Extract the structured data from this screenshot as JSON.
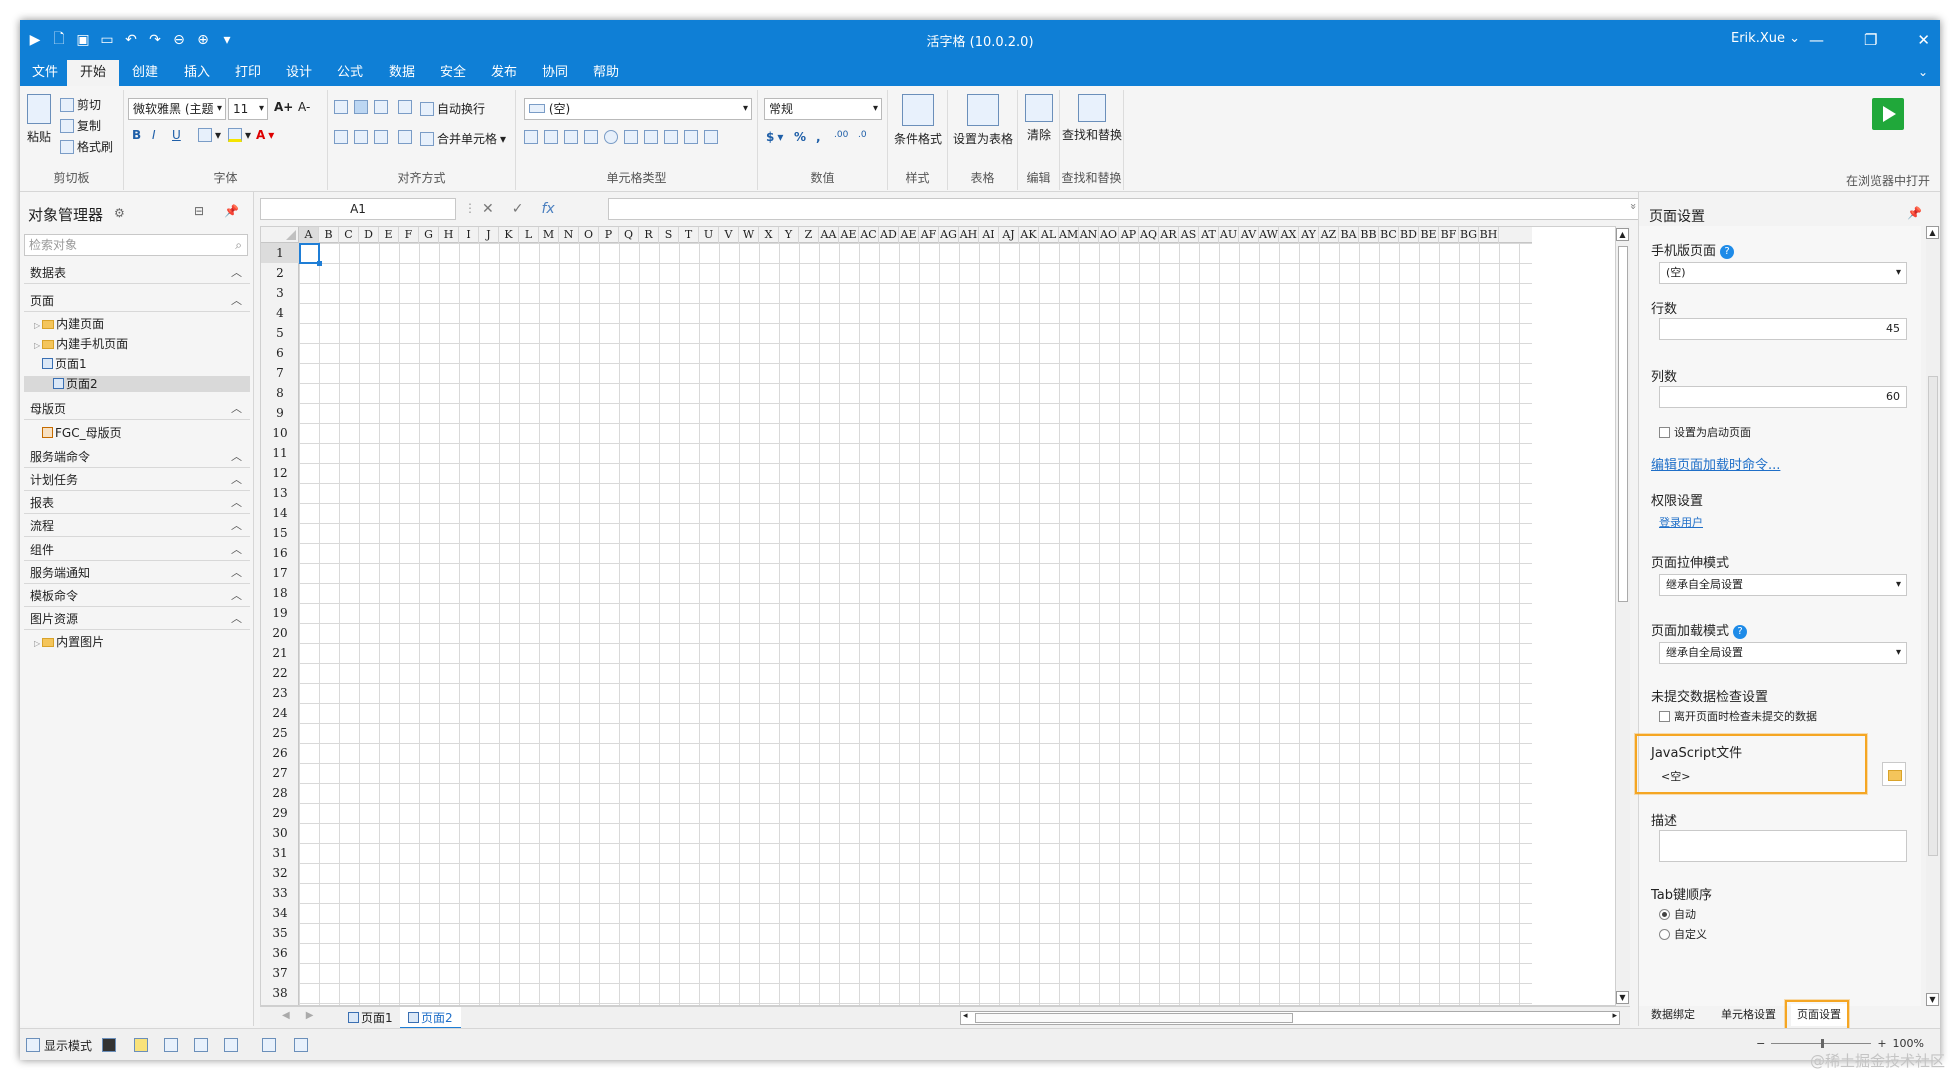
{
  "window": {
    "title": "活字格 (10.0.2.0)",
    "user": "Erik.Xue ⌄",
    "controls": [
      "—",
      "❐",
      "✕"
    ]
  },
  "menu": {
    "tabs": [
      "文件",
      "开始",
      "创建",
      "插入",
      "打印",
      "设计",
      "公式",
      "数据",
      "安全",
      "发布",
      "协同",
      "帮助"
    ],
    "active": "开始"
  },
  "ribbon": {
    "clipboard": {
      "paste": "粘贴",
      "cut": "剪切",
      "copy": "复制",
      "format_painter": "格式刷",
      "title": "剪切板"
    },
    "font": {
      "font_name": "微软雅黑 (主题",
      "font_size": "11",
      "bold": "B",
      "italic": "I",
      "underline": "U",
      "grow": "A+",
      "shrink": "A-",
      "title": "字体"
    },
    "alignment": {
      "wrap": "自动换行",
      "merge": "合并单元格",
      "title": "对齐方式"
    },
    "celltype": {
      "value": "(空)",
      "title": "单元格类型"
    },
    "number": {
      "format": "常规",
      "currency": "$",
      "percent": "%",
      "comma": ",",
      "inc": ".00",
      "dec": ".0",
      "title": "数值"
    },
    "style": {
      "conditional": "条件格式",
      "title": "样式"
    },
    "table": {
      "set_table": "设置为表格",
      "title": "表格"
    },
    "edit": {
      "clear": "清除",
      "title": "编辑"
    },
    "find": {
      "find_replace": "查找和替换",
      "title": "查找和替换"
    },
    "run": {
      "open_browser": "在浏览器中打开"
    }
  },
  "object_manager": {
    "title": "对象管理器",
    "search_placeholder": "检索对象",
    "sections": {
      "data_table": "数据表",
      "page": "页面",
      "master": "母版页",
      "server_cmd": "服务端命令",
      "scheduled": "计划任务",
      "report": "报表",
      "flow": "流程",
      "component": "组件",
      "server_notify": "服务端通知",
      "template_cmd": "模板命令",
      "image_res": "图片资源"
    },
    "items": {
      "builtin_pages": "内建页面",
      "builtin_mobile": "内建手机页面",
      "page1": "页面1",
      "page2": "页面2",
      "fgc_master": "FGC_母版页",
      "builtin_images": "内置图片"
    }
  },
  "formula_bar": {
    "cell_ref": "A1",
    "cancel": "✕",
    "confirm": "✓",
    "fx": "fx",
    "formula": ""
  },
  "sheet": {
    "columns": [
      "A",
      "B",
      "C",
      "D",
      "E",
      "F",
      "G",
      "H",
      "I",
      "J",
      "K",
      "L",
      "M",
      "N",
      "O",
      "P",
      "Q",
      "R",
      "S",
      "T",
      "U",
      "V",
      "W",
      "X",
      "Y",
      "Z",
      "AA",
      "AE",
      "AC",
      "AD",
      "AE",
      "AF",
      "AG",
      "AH",
      "AI",
      "AJ",
      "AK",
      "AL",
      "AM",
      "AN",
      "AO",
      "AP",
      "AQ",
      "AR",
      "AS",
      "AT",
      "AU",
      "AV",
      "AW",
      "AX",
      "AY",
      "AZ",
      "BA",
      "BB",
      "BC",
      "BD",
      "BE",
      "BF",
      "BG",
      "BH"
    ],
    "rows": [
      "1",
      "2",
      "3",
      "4",
      "5",
      "6",
      "7",
      "8",
      "9",
      "10",
      "11",
      "12",
      "13",
      "14",
      "15",
      "16",
      "17",
      "18",
      "19",
      "20",
      "21",
      "22",
      "23",
      "24",
      "25",
      "26",
      "27",
      "28",
      "29",
      "30",
      "31",
      "32",
      "33",
      "34",
      "35",
      "36",
      "37",
      "38"
    ],
    "tabs": [
      "页面1",
      "页面2"
    ],
    "active_tab": "页面2"
  },
  "page_settings": {
    "title": "页面设置",
    "mobile_page_label": "手机版页面",
    "mobile_page_value": "(空)",
    "rows_label": "行数",
    "rows_value": "45",
    "cols_label": "列数",
    "cols_value": "60",
    "startup_label": "设置为启动页面",
    "load_cmd_link": "编辑页面加载时命令...",
    "permission_label": "权限设置",
    "login_user_link": "登录用户",
    "stretch_label": "页面拉伸模式",
    "stretch_value": "继承自全局设置",
    "load_mode_label": "页面加载模式",
    "load_mode_value": "继承自全局设置",
    "unsubmitted_label": "未提交数据检查设置",
    "unsubmitted_check": "离开页面时检查未提交的数据",
    "js_label": "JavaScript文件",
    "js_value": "<空>",
    "desc_label": "描述",
    "tab_order_label": "Tab键顺序",
    "tab_order_auto": "自动",
    "tab_order_custom": "自定义",
    "bottom_tabs": [
      "数据绑定",
      "单元格设置",
      "页面设置"
    ],
    "active_bottom_tab": "页面设置"
  },
  "status": {
    "display_mode": "显示模式",
    "zoom": "100%"
  },
  "watermark": "@稀土掘金技术社区",
  "colors": {
    "titlebar": "#0f7fd6",
    "highlight": "#f5a623",
    "link": "#1f6fc8",
    "run": "#20a83a"
  }
}
